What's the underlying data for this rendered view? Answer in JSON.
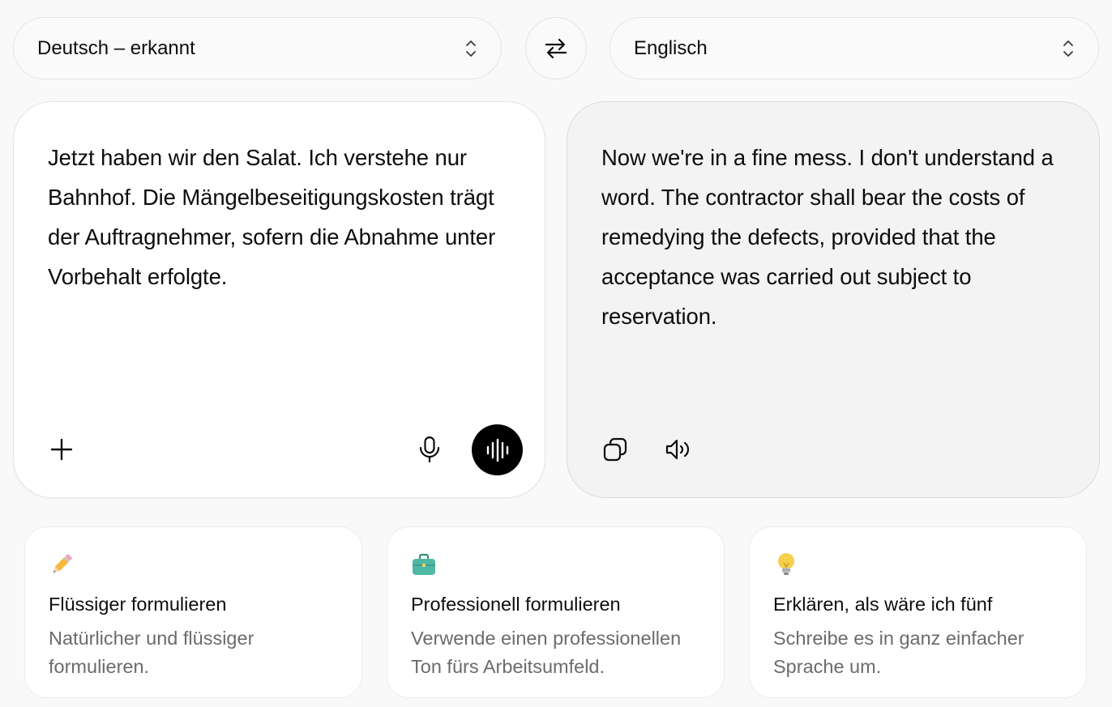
{
  "source": {
    "language": "Deutsch – erkannt",
    "text": "Jetzt haben wir den Salat. Ich verstehe nur Bahnhof. Die Mängelbeseitigungskosten trägt der Auftragnehmer, sofern die Abnahme unter Vorbehalt erfolgte."
  },
  "target": {
    "language": "Englisch",
    "text": "Now we're in a fine mess. I don't understand a word. The contractor shall bear the costs of remedying the defects, provided that the acceptance was carried out subject to reservation."
  },
  "icons": {
    "swap": "swap-arrows-icon",
    "chevron": "chevron-up-down-icon",
    "add": "plus-icon",
    "mic": "microphone-icon",
    "voice": "voice-waveform-icon",
    "copy": "copy-icon",
    "speaker": "speaker-icon"
  },
  "suggestions": [
    {
      "icon": "pencil-icon",
      "title": "Flüssiger formulieren",
      "description": "Natürlicher und flüssiger formulieren."
    },
    {
      "icon": "briefcase-icon",
      "title": "Professionell formulieren",
      "description": "Verwende einen professionellen Ton fürs Arbeitsumfeld."
    },
    {
      "icon": "light-bulb-icon",
      "title": "Erklären, als wäre ich fünf",
      "description": "Schreibe es in ganz einfacher Sprache um."
    }
  ],
  "colors": {
    "background": "#f9f9f9",
    "panel_source": "#ffffff",
    "panel_target": "#f3f3f3",
    "text_primary": "#0d0d0d",
    "text_secondary": "#6b6b6b",
    "voice_button": "#000000"
  }
}
